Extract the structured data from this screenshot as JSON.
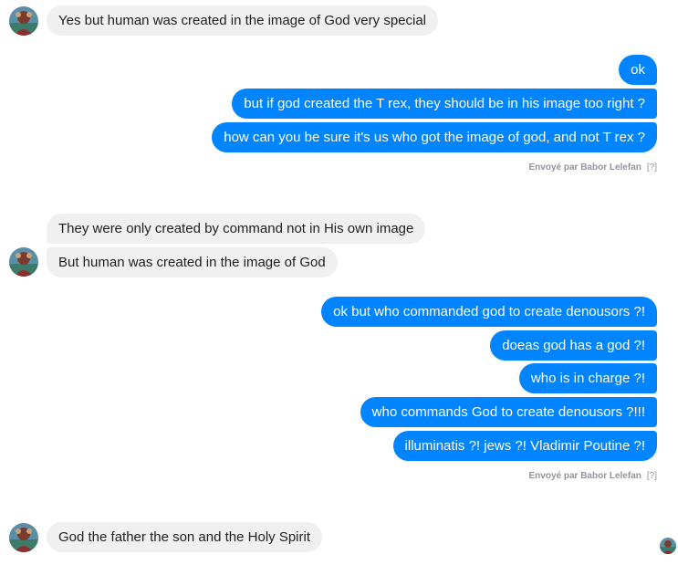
{
  "colors": {
    "outgoing_bubble": "#0084ff",
    "incoming_bubble": "#f0f0f0",
    "incoming_text": "#1c1e21",
    "meta_text": "#90949c"
  },
  "avatar_icon": "user-avatar-photo-icon",
  "messages": [
    {
      "from": "them",
      "text": "Yes but human was created in the image of God very special"
    },
    {
      "from": "me",
      "text": "ok"
    },
    {
      "from": "me",
      "text": "but if god created the T rex, they should be in his image too right ?"
    },
    {
      "from": "me",
      "text": "how can you be sure it's us who got the image of god, and not T rex ?"
    },
    {
      "from": "them",
      "text": "They were only created by command not in His own image"
    },
    {
      "from": "them",
      "text": "But human was created in the image of God"
    },
    {
      "from": "me",
      "text": "ok but who commanded god to create denousors ?!"
    },
    {
      "from": "me",
      "text": "doeas god has a god ?!"
    },
    {
      "from": "me",
      "text": "who is in charge ?!"
    },
    {
      "from": "me",
      "text": "who commands God to create denousors ?!!!"
    },
    {
      "from": "me",
      "text": "illuminatis ?! jews ?! Vladimir Poutine ?!"
    },
    {
      "from": "them",
      "text": "God the father the son and the Holy Spirit"
    }
  ],
  "sent_by": {
    "label": "Envoyé par Babor Lelefan",
    "help": "[?]"
  }
}
